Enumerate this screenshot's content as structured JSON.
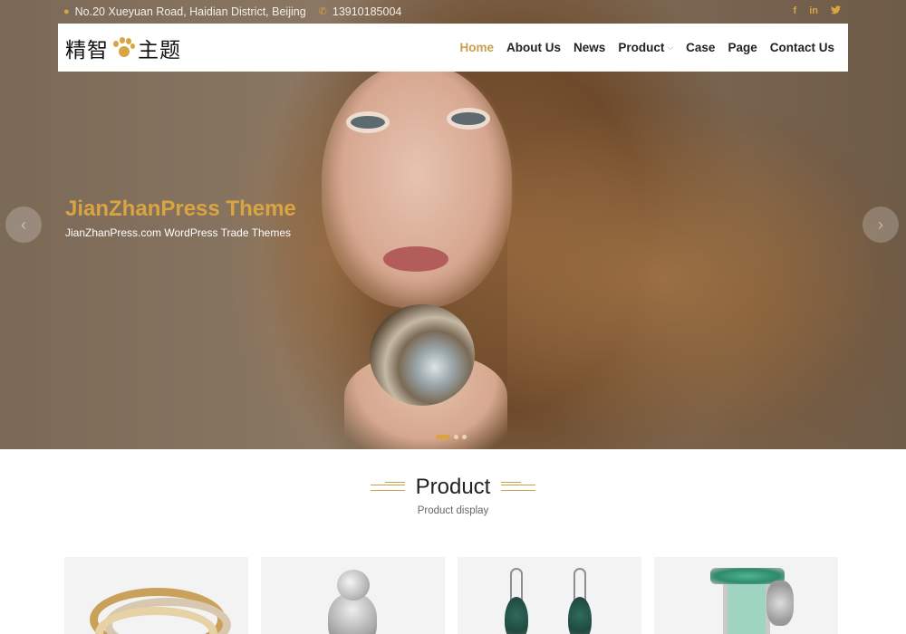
{
  "topbar": {
    "address": "No.20 Xueyuan Road, Haidian District, Beijing",
    "phone": "13910185004",
    "social": [
      "f",
      "in",
      "t"
    ]
  },
  "header": {
    "logo_left": "精智",
    "logo_right": "主题",
    "nav": [
      {
        "label": "Home",
        "active": true
      },
      {
        "label": "About Us"
      },
      {
        "label": "News"
      },
      {
        "label": "Product",
        "has_dropdown": true
      },
      {
        "label": "Case"
      },
      {
        "label": "Page"
      },
      {
        "label": "Contact Us"
      }
    ]
  },
  "slider": {
    "title": "JianZhanPress Theme",
    "subtitle": "JianZhanPress.com WordPress Trade Themes",
    "prev": "‹",
    "next": "›",
    "slide_count": 3,
    "current_slide": 1
  },
  "products_section": {
    "title": "Product",
    "subtitle": "Product display",
    "items": [
      "ring",
      "bird-brooch",
      "earrings",
      "watch"
    ]
  },
  "colors": {
    "accent": "#d9a441",
    "nav_active": "#c9a04a",
    "card_bg": "#f3f3f3"
  }
}
